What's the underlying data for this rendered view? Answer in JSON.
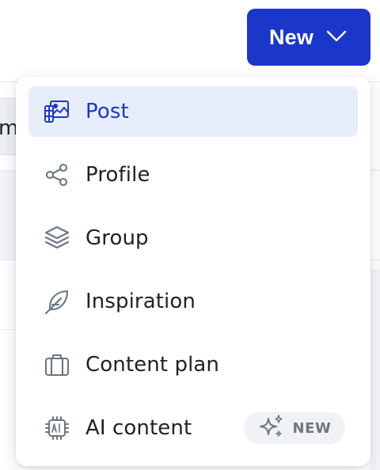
{
  "header": {
    "new_button": {
      "label": "New",
      "icon": "chevron-down-icon"
    }
  },
  "background": {
    "tab_fragment": "m"
  },
  "menu": {
    "items": [
      {
        "label": "Post",
        "icon": "post-media-icon",
        "active": true
      },
      {
        "label": "Profile",
        "icon": "share-nodes-icon",
        "active": false
      },
      {
        "label": "Group",
        "icon": "layers-icon",
        "active": false
      },
      {
        "label": "Inspiration",
        "icon": "feather-icon",
        "active": false
      },
      {
        "label": "Content plan",
        "icon": "briefcase-icon",
        "active": false
      },
      {
        "label": "AI content",
        "icon": "ai-chip-icon",
        "active": false,
        "badge": {
          "label": "NEW",
          "icon": "sparkle-icon"
        }
      }
    ]
  },
  "colors": {
    "accent": "#1b37c9",
    "active_bg": "#e8edfc",
    "icon_gray": "#6b7686",
    "text": "#1d2129",
    "badge_bg": "#f0f2f5"
  }
}
